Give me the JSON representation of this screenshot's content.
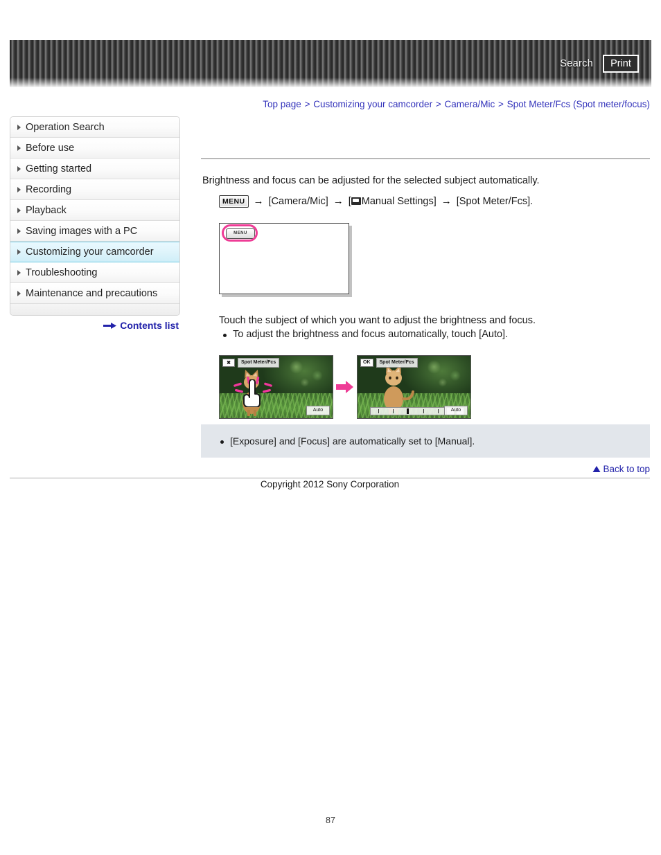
{
  "header": {
    "search_label": "Search",
    "print_label": "Print"
  },
  "breadcrumb": {
    "separator": ">",
    "items": [
      {
        "label": "Top page"
      },
      {
        "label": "Customizing your camcorder"
      },
      {
        "label": "Camera/Mic"
      },
      {
        "label": "Spot Meter/Fcs (Spot meter/focus)"
      }
    ]
  },
  "sidebar": {
    "items": [
      {
        "label": "Operation Search",
        "active": false
      },
      {
        "label": "Before use",
        "active": false
      },
      {
        "label": "Getting started",
        "active": false
      },
      {
        "label": "Recording",
        "active": false
      },
      {
        "label": "Playback",
        "active": false
      },
      {
        "label": "Saving images with a PC",
        "active": false
      },
      {
        "label": "Customizing your camcorder",
        "active": true
      },
      {
        "label": "Troubleshooting",
        "active": false
      },
      {
        "label": "Maintenance and precautions",
        "active": false
      }
    ],
    "contents_list_label": "Contents list"
  },
  "main": {
    "intro": "Brightness and focus can be adjusted for the selected subject automatically.",
    "menu_path": {
      "menu_chip": "MENU",
      "arrow": "→",
      "step1": "[Camera/Mic]",
      "step2_prefix": "[",
      "step2": "Manual Settings]",
      "step3": "[Spot Meter/Fcs]."
    },
    "illustration": {
      "menu_button_label": "MENU"
    },
    "step_text": "Touch the subject of which you want to adjust the brightness and focus.",
    "step_bullet": "To adjust the brightness and focus automatically, touch [Auto].",
    "camera_shots": [
      {
        "close_label": "✖",
        "title": "Spot Meter/Fcs",
        "auto_label": "Auto"
      },
      {
        "ok_label": "OK",
        "title": "Spot Meter/Fcs",
        "auto_label": "Auto"
      }
    ],
    "note": "[Exposure] and [Focus] are automatically set to [Manual]."
  },
  "footer": {
    "back_to_top_label": "Back to top",
    "copyright": "Copyright 2012 Sony Corporation",
    "page_number": "87"
  },
  "colors": {
    "link": "#3333bb",
    "accent_pink": "#ee3c96",
    "active_nav": "#cfeef8",
    "note_bg": "#e2e6eb"
  }
}
